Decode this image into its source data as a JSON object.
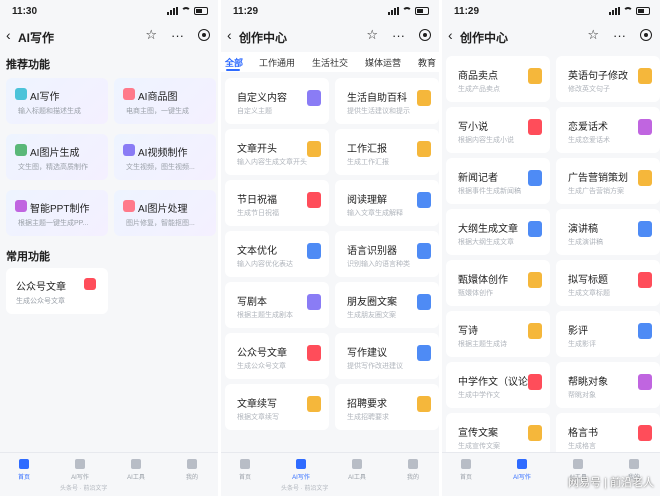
{
  "colors": {
    "accent": "#2f6bff",
    "bg": "#f6f7f9"
  },
  "panel1": {
    "time": "11:30",
    "title": "AI写作",
    "section_recommended": "推荐功能",
    "section_common": "常用功能",
    "cards": [
      {
        "title": "AI写作",
        "sub": "输入标题和描述生成",
        "icon": "doc-icon",
        "color": "#4cc3d9"
      },
      {
        "title": "AI商品图",
        "sub": "电商主图，一键生成",
        "icon": "product-icon",
        "color": "#ff7a8a"
      },
      {
        "title": "AI图片生成",
        "sub": "文生图，精选高质制作",
        "icon": "landscape-icon",
        "color": "#5ab878"
      },
      {
        "title": "AI视频制作",
        "sub": "文生视频，图生视频...",
        "icon": "video-icon",
        "color": "#8a7cf5"
      },
      {
        "title": "智能PPT制作",
        "sub": "根据主题一键生成PP...",
        "icon": "ppt-icon",
        "color": "#c065e0"
      },
      {
        "title": "AI图片处理",
        "sub": "图片修复，智能抠图...",
        "icon": "image-edit-icon",
        "color": "#ff7a8a"
      }
    ],
    "common": [
      {
        "title": "公众号文章",
        "sub": "生成公众号文章",
        "icon": "pen-icon",
        "color": "#ff4d5a"
      }
    ]
  },
  "panel2": {
    "time": "11:29",
    "title": "创作中心",
    "tabs": [
      "全部",
      "工作通用",
      "生活社交",
      "媒体运营",
      "教育"
    ],
    "tiles": [
      {
        "title": "自定义内容",
        "sub": "自定义主题",
        "color": "#8a7cf5"
      },
      {
        "title": "生活自助百科",
        "sub": "提供生活建议和提示",
        "color": "#f5b73b"
      },
      {
        "title": "文章开头",
        "sub": "输入内容生成文章开头",
        "color": "#f5b73b"
      },
      {
        "title": "工作汇报",
        "sub": "生成工作汇报",
        "color": "#f5b73b"
      },
      {
        "title": "节日祝福",
        "sub": "生成节日祝福",
        "color": "#ff4d5a"
      },
      {
        "title": "阅读理解",
        "sub": "输入文章生成解释",
        "color": "#4e8bf5"
      },
      {
        "title": "文本优化",
        "sub": "输入内容优化表达",
        "color": "#4e8bf5"
      },
      {
        "title": "语言识别器",
        "sub": "识别输入的语言种类",
        "color": "#4e8bf5"
      },
      {
        "title": "写剧本",
        "sub": "根据主题生成剧本",
        "color": "#8a7cf5"
      },
      {
        "title": "朋友圈文案",
        "sub": "生成朋友圈文案",
        "color": "#4e8bf5"
      },
      {
        "title": "公众号文章",
        "sub": "生成公众号文章",
        "color": "#ff4d5a"
      },
      {
        "title": "写作建议",
        "sub": "提供写作改进建议",
        "color": "#4e8bf5"
      },
      {
        "title": "文章续写",
        "sub": "根据文章续写",
        "color": "#f5b73b"
      },
      {
        "title": "招聘要求",
        "sub": "生成招聘要求",
        "color": "#f5b73b"
      }
    ]
  },
  "panel3": {
    "time": "11:29",
    "title": "创作中心",
    "tiles": [
      {
        "title": "商品卖点",
        "sub": "生成产品卖点",
        "color": "#f5b73b"
      },
      {
        "title": "英语句子修改",
        "sub": "修改英文句子",
        "color": "#f5b73b"
      },
      {
        "title": "写小说",
        "sub": "根据内容生成小说",
        "color": "#ff4d5a"
      },
      {
        "title": "恋爱话术",
        "sub": "生成恋爱话术",
        "color": "#c065e0"
      },
      {
        "title": "新闻记者",
        "sub": "根据事件生成新闻稿",
        "color": "#4e8bf5"
      },
      {
        "title": "广告营销策划",
        "sub": "生成广告营销方案",
        "color": "#f5b73b"
      },
      {
        "title": "大纲生成文章",
        "sub": "根据大纲生成文章",
        "color": "#4e8bf5"
      },
      {
        "title": "演讲稿",
        "sub": "生成演讲稿",
        "color": "#4e8bf5"
      },
      {
        "title": "甄嬛体创作",
        "sub": "甄嬛体创作",
        "color": "#f5b73b"
      },
      {
        "title": "拟写标题",
        "sub": "生成文章标题",
        "color": "#ff4d5a"
      },
      {
        "title": "写诗",
        "sub": "根据主题生成诗",
        "color": "#f5b73b"
      },
      {
        "title": "影评",
        "sub": "生成影评",
        "color": "#4e8bf5"
      },
      {
        "title": "中学作文（议论文）",
        "sub": "生成中学作文",
        "color": "#ff4d5a"
      },
      {
        "title": "帮眺对象",
        "sub": "帮眺对象",
        "color": "#c065e0"
      },
      {
        "title": "宣传文案",
        "sub": "生成宣传文案",
        "color": "#f5b73b"
      },
      {
        "title": "格言书",
        "sub": "生成格言",
        "color": "#ff4d5a"
      }
    ]
  },
  "bottom": {
    "items": [
      "首页",
      "AI写作",
      "AI工具",
      "我的"
    ],
    "watermark_small": "头条号 · 前沿文字"
  },
  "watermark": "网易号 | 前沿老人"
}
